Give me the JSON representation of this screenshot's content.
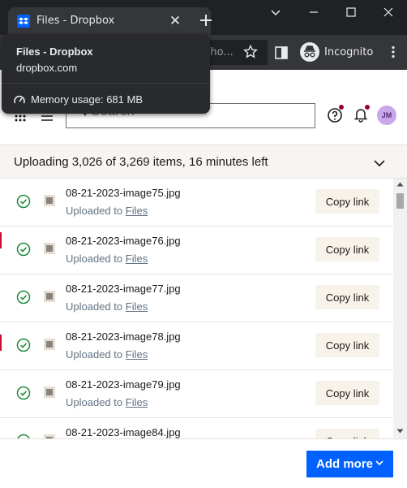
{
  "browser": {
    "tab_title": "Files - Dropbox",
    "url_fragment": "/ho...",
    "incognito_label": "Incognito"
  },
  "tooltip": {
    "title": "Files - Dropbox",
    "domain": "dropbox.com",
    "memory": "Memory usage: 681 MB"
  },
  "header": {
    "search_placeholder": "Search",
    "avatar_initials": "JM"
  },
  "upload": {
    "status": "Uploading 3,026 of 3,269 items, 16 minutes left",
    "location_prefix": "Uploaded to",
    "location_link": "Files",
    "copy_label": "Copy link",
    "items": [
      {
        "name": "08-21-2023-image75.jpg"
      },
      {
        "name": "08-21-2023-image76.jpg"
      },
      {
        "name": "08-21-2023-image77.jpg"
      },
      {
        "name": "08-21-2023-image78.jpg"
      },
      {
        "name": "08-21-2023-image79.jpg"
      },
      {
        "name": "08-21-2023-image84.jpg"
      }
    ]
  },
  "footer": {
    "add_more_label": "Add more"
  },
  "colors": {
    "accent": "#0061fe",
    "success": "#1f8a3b",
    "chrome_dark": "#202124",
    "banner_bg": "#f7f5f2"
  }
}
